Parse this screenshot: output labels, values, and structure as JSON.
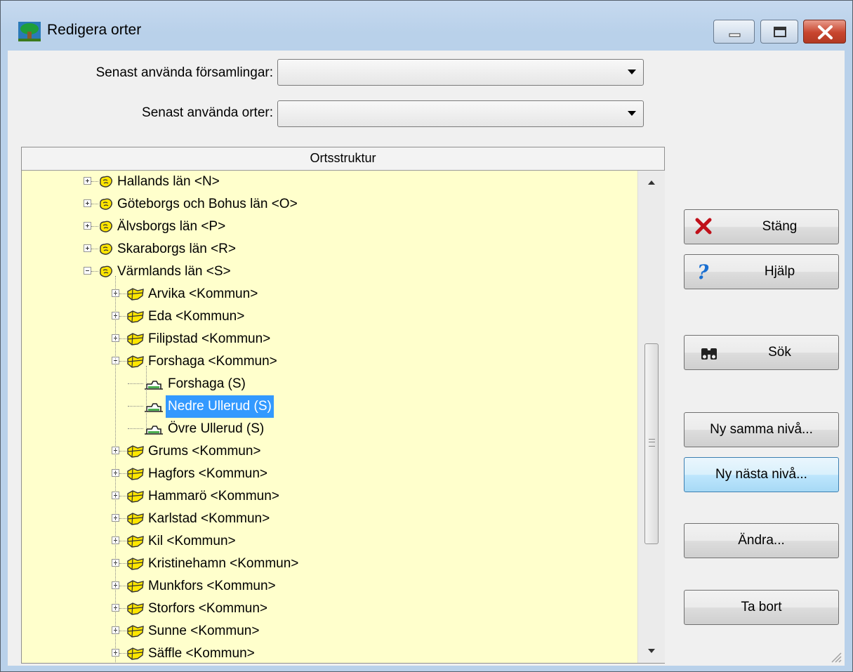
{
  "window": {
    "title": "Redigera orter",
    "app_icon": "tree-icon",
    "controls": [
      "minimize-icon",
      "maximize-icon",
      "close-icon"
    ]
  },
  "form": {
    "recent_parishes_label": "Senast använda församlingar:",
    "recent_parishes_value": "",
    "recent_places_label": "Senast använda orter:",
    "recent_places_value": ""
  },
  "tree": {
    "header": "Ortsstruktur",
    "rows": [
      {
        "label": "Hallands län <N>",
        "level": 0,
        "type": "county",
        "expander": "plus"
      },
      {
        "label": "Göteborgs och Bohus län <O>",
        "level": 0,
        "type": "county",
        "expander": "plus"
      },
      {
        "label": "Älvsborgs län <P>",
        "level": 0,
        "type": "county",
        "expander": "plus"
      },
      {
        "label": "Skaraborgs län <R>",
        "level": 0,
        "type": "county",
        "expander": "plus"
      },
      {
        "label": "Värmlands län <S>",
        "level": 0,
        "type": "county",
        "expander": "minus"
      },
      {
        "label": "Arvika <Kommun>",
        "level": 1,
        "type": "municipality",
        "expander": "plus"
      },
      {
        "label": "Eda <Kommun>",
        "level": 1,
        "type": "municipality",
        "expander": "plus"
      },
      {
        "label": "Filipstad <Kommun>",
        "level": 1,
        "type": "municipality",
        "expander": "plus"
      },
      {
        "label": "Forshaga <Kommun>",
        "level": 1,
        "type": "municipality",
        "expander": "minus"
      },
      {
        "label": "Forshaga (S)",
        "level": 2,
        "type": "parish",
        "expander": "none"
      },
      {
        "label": "Nedre Ullerud (S)",
        "level": 2,
        "type": "parish",
        "expander": "none",
        "selected": true
      },
      {
        "label": "Övre Ullerud (S)",
        "level": 2,
        "type": "parish",
        "expander": "none"
      },
      {
        "label": "Grums <Kommun>",
        "level": 1,
        "type": "municipality",
        "expander": "plus"
      },
      {
        "label": "Hagfors <Kommun>",
        "level": 1,
        "type": "municipality",
        "expander": "plus"
      },
      {
        "label": "Hammarö <Kommun>",
        "level": 1,
        "type": "municipality",
        "expander": "plus"
      },
      {
        "label": "Karlstad <Kommun>",
        "level": 1,
        "type": "municipality",
        "expander": "plus"
      },
      {
        "label": "Kil <Kommun>",
        "level": 1,
        "type": "municipality",
        "expander": "plus"
      },
      {
        "label": "Kristinehamn <Kommun>",
        "level": 1,
        "type": "municipality",
        "expander": "plus"
      },
      {
        "label": "Munkfors <Kommun>",
        "level": 1,
        "type": "municipality",
        "expander": "plus"
      },
      {
        "label": "Storfors <Kommun>",
        "level": 1,
        "type": "municipality",
        "expander": "plus"
      },
      {
        "label": "Sunne <Kommun>",
        "level": 1,
        "type": "municipality",
        "expander": "plus"
      },
      {
        "label": "Säffle <Kommun>",
        "level": 1,
        "type": "municipality",
        "expander": "plus"
      }
    ]
  },
  "buttons": {
    "close": {
      "label": "Stäng",
      "icon": "red-x-icon"
    },
    "help": {
      "label": "Hjälp",
      "icon": "question-mark-icon"
    },
    "search": {
      "label": "Sök",
      "icon": "binoculars-icon"
    },
    "new_same_level": {
      "label": "Ny samma nivå..."
    },
    "new_next_level": {
      "label": "Ny nästa nivå..."
    },
    "edit": {
      "label": "Ändra..."
    },
    "delete": {
      "label": "Ta bort"
    }
  },
  "colors": {
    "tree_background": "#ffffcc",
    "selection": "#3399ff",
    "title_bar": "#b9d1ea"
  }
}
